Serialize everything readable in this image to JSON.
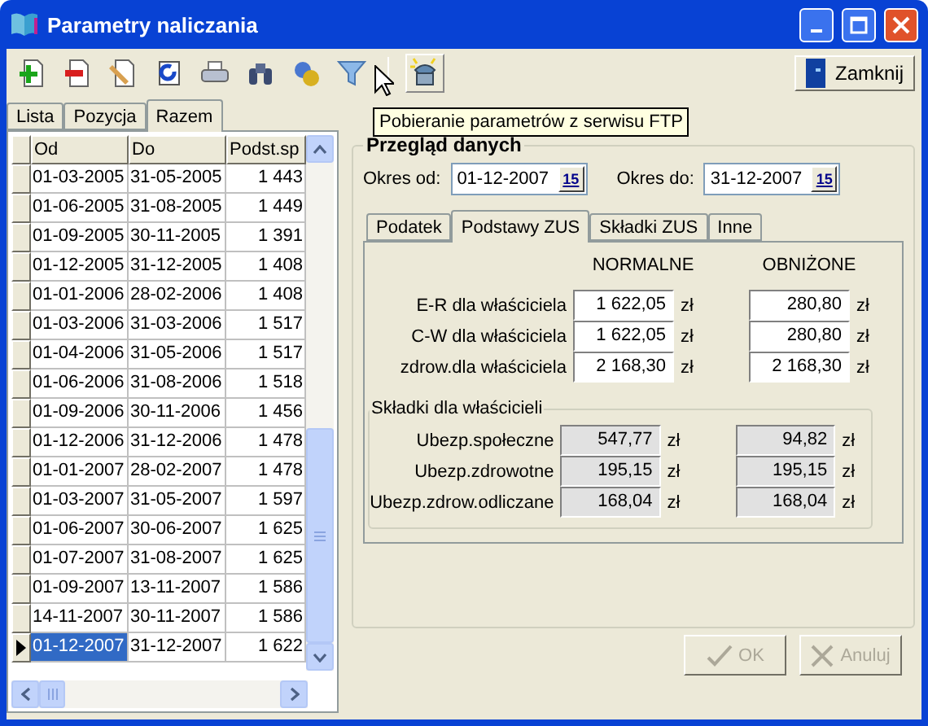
{
  "window": {
    "title": "Parametry naliczania"
  },
  "toolbar": {
    "close_button": "Zamknij",
    "tooltip": "Pobieranie parametrów z serwisu FTP"
  },
  "tabs": [
    {
      "label": "Lista",
      "selected": false
    },
    {
      "label": "Pozycja",
      "selected": false
    },
    {
      "label": "Razem",
      "selected": true
    }
  ],
  "grid": {
    "columns": [
      "Od",
      "Do",
      "Podst.sp"
    ],
    "rows": [
      {
        "cells": [
          "01-03-2005",
          "31-05-2005",
          "1 443"
        ],
        "selected": false
      },
      {
        "cells": [
          "01-06-2005",
          "31-08-2005",
          "1 449"
        ],
        "selected": false
      },
      {
        "cells": [
          "01-09-2005",
          "30-11-2005",
          "1 391"
        ],
        "selected": false
      },
      {
        "cells": [
          "01-12-2005",
          "31-12-2005",
          "1 408"
        ],
        "selected": false
      },
      {
        "cells": [
          "01-01-2006",
          "28-02-2006",
          "1 408"
        ],
        "selected": false
      },
      {
        "cells": [
          "01-03-2006",
          "31-03-2006",
          "1 517"
        ],
        "selected": false
      },
      {
        "cells": [
          "01-04-2006",
          "31-05-2006",
          "1 517"
        ],
        "selected": false
      },
      {
        "cells": [
          "01-06-2006",
          "31-08-2006",
          "1 518"
        ],
        "selected": false
      },
      {
        "cells": [
          "01-09-2006",
          "30-11-2006",
          "1 456"
        ],
        "selected": false
      },
      {
        "cells": [
          "01-12-2006",
          "31-12-2006",
          "1 478"
        ],
        "selected": false
      },
      {
        "cells": [
          "01-01-2007",
          "28-02-2007",
          "1 478"
        ],
        "selected": false
      },
      {
        "cells": [
          "01-03-2007",
          "31-05-2007",
          "1 597"
        ],
        "selected": false
      },
      {
        "cells": [
          "01-06-2007",
          "30-06-2007",
          "1 625"
        ],
        "selected": false
      },
      {
        "cells": [
          "01-07-2007",
          "31-08-2007",
          "1 625"
        ],
        "selected": false
      },
      {
        "cells": [
          "01-09-2007",
          "13-11-2007",
          "1 586"
        ],
        "selected": false
      },
      {
        "cells": [
          "14-11-2007",
          "30-11-2007",
          "1 586"
        ],
        "selected": false
      },
      {
        "cells": [
          "01-12-2007",
          "31-12-2007",
          "1 622"
        ],
        "selected": true
      }
    ]
  },
  "group": {
    "title": "Przegląd danych",
    "periods": [
      {
        "label": "Okres od:",
        "value": "01-12-2007",
        "calendar": "15"
      },
      {
        "label": "Okres do:",
        "value": "31-12-2007",
        "calendar": "15"
      }
    ],
    "inner_tabs": [
      {
        "label": "Podatek",
        "selected": false
      },
      {
        "label": "Podstawy ZUS",
        "selected": true
      },
      {
        "label": "Składki ZUS",
        "selected": false
      },
      {
        "label": "Inne",
        "selected": false
      }
    ],
    "headers": [
      "NORMALNE",
      "OBNIŻONE"
    ],
    "base_rows": [
      {
        "label": "E-R dla właściciela",
        "values": [
          "1 622,05",
          "280,80"
        ],
        "units": [
          "zł",
          "zł"
        ],
        "readonly": false
      },
      {
        "label": "C-W dla właściciela",
        "values": [
          "1 622,05",
          "280,80"
        ],
        "units": [
          "zł",
          "zł"
        ],
        "readonly": false
      },
      {
        "label": "zdrow.dla właściciela",
        "values": [
          "2 168,30",
          "2 168,30"
        ],
        "units": [
          "zł",
          "zł"
        ],
        "readonly": false
      }
    ],
    "contributions": {
      "title": "Składki dla właścicieli",
      "rows": [
        {
          "label": "Ubezp.społeczne",
          "values": [
            "547,77",
            "94,82"
          ],
          "units": [
            "zł",
            "zł"
          ],
          "readonly": true
        },
        {
          "label": "Ubezp.zdrowotne",
          "values": [
            "195,15",
            "195,15"
          ],
          "units": [
            "zł",
            "zł"
          ],
          "readonly": true
        },
        {
          "label": "Ubezp.zdrow.odliczane",
          "values": [
            "168,04",
            "168,04"
          ],
          "units": [
            "zł",
            "zł"
          ],
          "readonly": true
        }
      ]
    }
  },
  "buttons": [
    {
      "label": "OK",
      "kind": "ok",
      "disabled": true
    },
    {
      "label": "Anuluj",
      "kind": "cancel",
      "disabled": true
    }
  ]
}
